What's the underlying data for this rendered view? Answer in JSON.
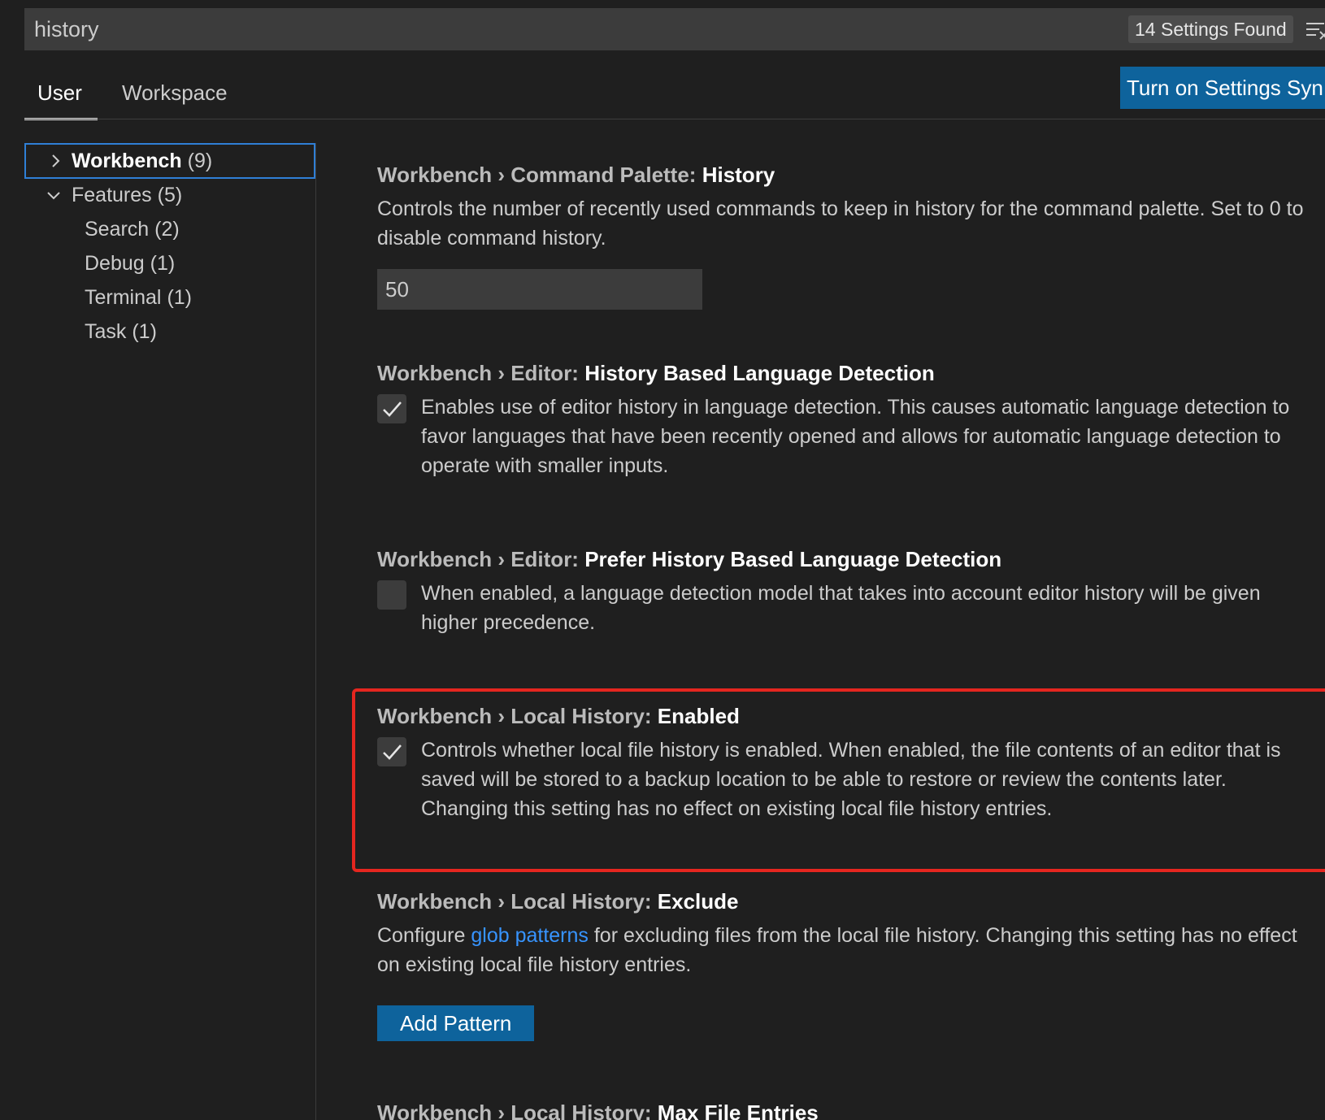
{
  "search": {
    "value": "history",
    "results_badge": "14 Settings Found"
  },
  "tabs": [
    {
      "label": "User",
      "active": true
    },
    {
      "label": "Workspace",
      "active": false
    }
  ],
  "sync_button": {
    "label": "Turn on Settings Syn"
  },
  "toc": {
    "items": [
      {
        "label": "Workbench",
        "count": "(9)",
        "state": "collapsed",
        "selected": true
      },
      {
        "label": "Features",
        "count": "(5)",
        "state": "expanded",
        "selected": false
      },
      {
        "label": "Search",
        "count": "(2)"
      },
      {
        "label": "Debug",
        "count": "(1)"
      },
      {
        "label": "Terminal",
        "count": "(1)"
      },
      {
        "label": "Task",
        "count": "(1)"
      }
    ]
  },
  "settings": [
    {
      "category": "Workbench › Command Palette: ",
      "name": "History",
      "description": "Controls the number of recently used commands to keep in history for the command palette. Set to 0 to disable command history.",
      "value": "50"
    },
    {
      "category": "Workbench › Editor: ",
      "name": "History Based Language Detection",
      "description": "Enables use of editor history in language detection. This causes automatic language detection to favor languages that have been recently opened and allows for automatic language detection to operate with smaller inputs.",
      "checked": true
    },
    {
      "category": "Workbench › Editor: ",
      "name": "Prefer History Based Language Detection",
      "description": "When enabled, a language detection model that takes into account editor history will be given higher precedence.",
      "checked": false
    },
    {
      "category": "Workbench › Local History: ",
      "name": "Enabled",
      "description": "Controls whether local file history is enabled. When enabled, the file contents of an editor that is saved will be stored to a backup location to be able to restore or review the contents later. Changing this setting has no effect on existing local file history entries.",
      "checked": true
    },
    {
      "category": "Workbench › Local History: ",
      "name": "Exclude",
      "description_before": "Configure ",
      "description_link": "glob patterns",
      "description_after": " for excluding files from the local file history. Changing this setting has no effect on existing local file history entries.",
      "button": "Add Pattern"
    },
    {
      "category": "Workbench › Local History: ",
      "name": "Max File Entries"
    }
  ],
  "colors": {
    "background": "#1f1f1f",
    "accent_button": "#0e639c",
    "link": "#3794ff",
    "highlight": "#e5261f"
  }
}
